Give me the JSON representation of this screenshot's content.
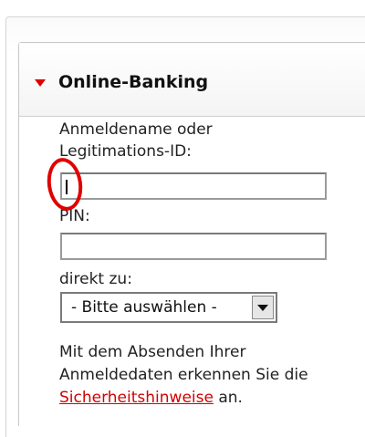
{
  "panel": {
    "title": "Online-Banking"
  },
  "login": {
    "username_label_line1": "Anmeldename oder",
    "username_label_line2": "Legitimations-ID:",
    "username_value": "",
    "pin_label": "PIN:",
    "pin_value": "",
    "destination_label": "direkt zu:",
    "destination_selected": "- Bitte auswählen -"
  },
  "notice": {
    "text_before": "Mit dem Absenden Ihrer Anmeldedaten erkennen Sie die",
    "link_text": "Sicherheitshinweise",
    "text_after": "an."
  },
  "colors": {
    "accent": "#e00000",
    "link": "#d40000",
    "annotation_circle": "#e00000"
  },
  "icons": {
    "section_toggle": "triangle-down-icon",
    "select_arrow": "chevron-down-icon"
  }
}
